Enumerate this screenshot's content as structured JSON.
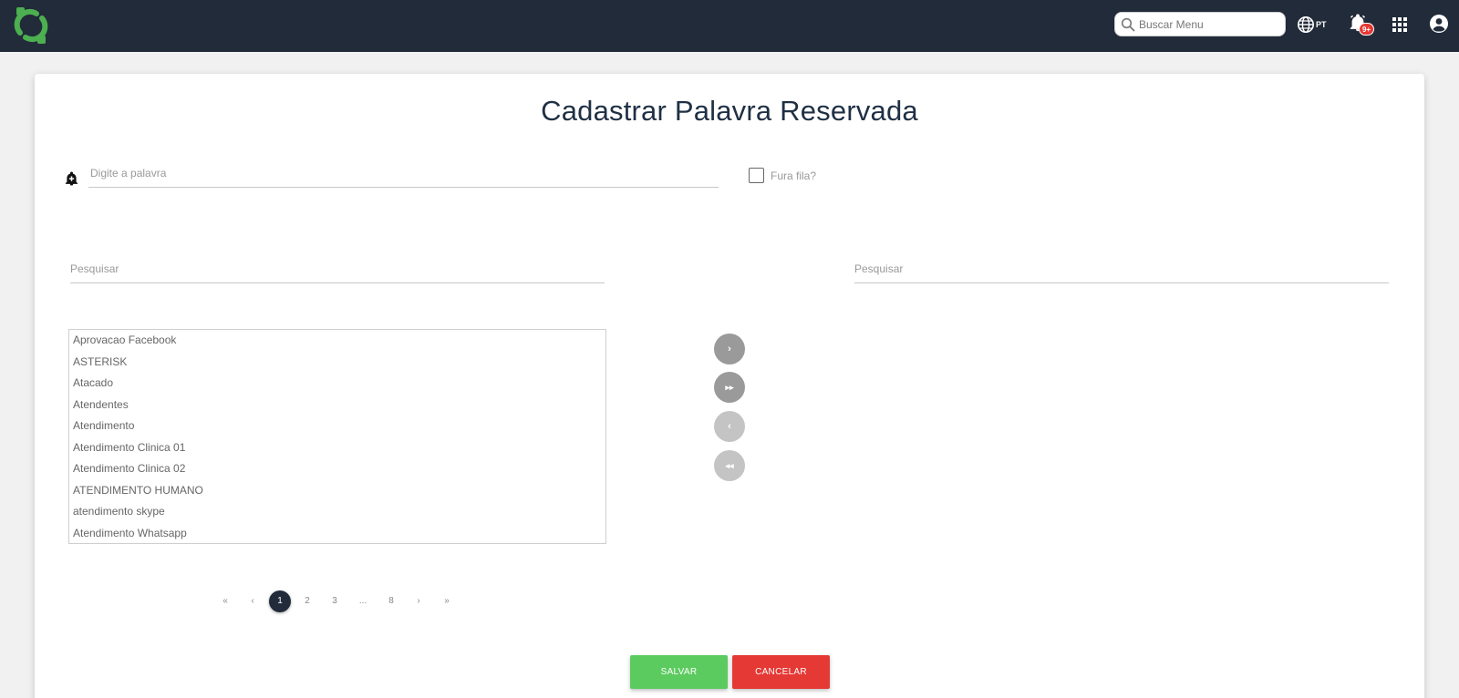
{
  "header": {
    "logo_icon": "refresh-cycle-logo",
    "brand_color": "#4caf50",
    "search_placeholder": "Buscar Menu",
    "language_code": "PT",
    "notification_badge": "9+",
    "bar_color": "#222b3a"
  },
  "page": {
    "title": "Cadastrar Palavra Reservada",
    "word_placeholder": "Digite a palavra",
    "checkbox_label": "Fura fila?",
    "checkbox_checked": false,
    "search_left_placeholder": "Pesquisar",
    "search_right_placeholder": "Pesquisar"
  },
  "available_list": [
    "Aprovacao Facebook",
    "ASTERISK",
    "Atacado",
    "Atendentes",
    "Atendimento",
    "Atendimento Clinica 01",
    "Atendimento Clinica 02",
    "ATENDIMENTO HUMANO",
    "atendimento skype",
    "Atendimento Whatsapp"
  ],
  "transfer_buttons": {
    "move_right": "›",
    "move_all_right": "▸▸",
    "move_left": "‹",
    "move_all_left": "◂◂"
  },
  "pagination": {
    "first": "«",
    "prev": "‹",
    "pages": [
      "1",
      "2",
      "3",
      "...",
      "8"
    ],
    "next": "›",
    "last": "»",
    "current": "1"
  },
  "actions": {
    "save_label": "SALVAR",
    "cancel_label": "CANCELAR",
    "save_color": "#5ccb5f",
    "cancel_color": "#e53935"
  }
}
